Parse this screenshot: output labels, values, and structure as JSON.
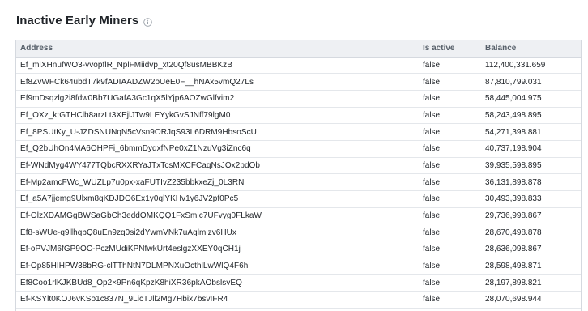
{
  "page": {
    "title": "Inactive Early Miners",
    "info_icon": "info-circle-icon"
  },
  "table": {
    "columns": [
      "Address",
      "Is active",
      "Balance"
    ],
    "rows": [
      {
        "address": "Ef_mlXHnufWO3-vvopflR_NplFMiidvp_xt20Qf8usMBBKzB",
        "is_active": "false",
        "balance": "112,400,331.659"
      },
      {
        "address": "Ef8ZvWFCk64ubdT7k9fADIAADZW2oUeE0F__hNAx5vmQ27Ls",
        "is_active": "false",
        "balance": "87,810,799.031"
      },
      {
        "address": "Ef9mDsqzlg2i8fdw0Bb7UGafA3Gc1qX5lYjp6AOZwGlfvim2",
        "is_active": "false",
        "balance": "58,445,004.975"
      },
      {
        "address": "Ef_OXz_ktGTHClb8arzLt3XEjlJTw9LEYykGvSJNff79lgM0",
        "is_active": "false",
        "balance": "58,243,498.895"
      },
      {
        "address": "Ef_8PSUtKy_U-JZDSNUNqN5cVsn9ORJqS93L6DRM9HbsoScU",
        "is_active": "false",
        "balance": "54,271,398.881"
      },
      {
        "address": "Ef_Q2bUhOn4MA6OHPFi_6bmmDyqxfNPe0xZ1NzuVg3iZnc6q",
        "is_active": "false",
        "balance": "40,737,198.904"
      },
      {
        "address": "Ef-WNdMyg4WY477TQbcRXXRYaJTxTcsMXCFCaqNsJOx2bdOb",
        "is_active": "false",
        "balance": "39,935,598.895"
      },
      {
        "address": "Ef-Mp2amcFWc_WUZLp7u0px-xaFUTIvZ235bbkxeZj_0L3RN",
        "is_active": "false",
        "balance": "36,131,898.878"
      },
      {
        "address": "Ef_a5A7jjemg9Ulxm8qKDJDO6Ex1y0qlYKHv1y6JV2pf0Pc5",
        "is_active": "false",
        "balance": "30,493,398.833"
      },
      {
        "address": "Ef-OlzXDAMGgBWSaGbCh3eddOMKQQ1FxSmlc7UFvyg0FLkaW",
        "is_active": "false",
        "balance": "29,736,998.867"
      },
      {
        "address": "Ef8-sWUe-q9llhqbQ8uEn9zq0si2dYwmVNk7uAglmlzv6HUx",
        "is_active": "false",
        "balance": "28,670,498.878"
      },
      {
        "address": "Ef-oPVJM6fGP9OC-PczMUdiKPNfwkUrt4eslgzXXEY0qCH1j",
        "is_active": "false",
        "balance": "28,636,098.867"
      },
      {
        "address": "Ef-Op85HIHPW38bRG-clTThNtN7DLMPNXuOcthlLwWlQ4F6h",
        "is_active": "false",
        "balance": "28,598,498.871"
      },
      {
        "address": "Ef8Coo1rlKJKBUd8_Op2×9Pn6qKpzK8hiXR36pkAObslsvEQ",
        "is_active": "false",
        "balance": "28,197,898.821"
      },
      {
        "address": "Ef-KSYlt0KOJ6vKSo1c837N_9LicTJll2Mg7Hbix7bsvIFR4",
        "is_active": "false",
        "balance": "28,070,698.944"
      }
    ]
  }
}
